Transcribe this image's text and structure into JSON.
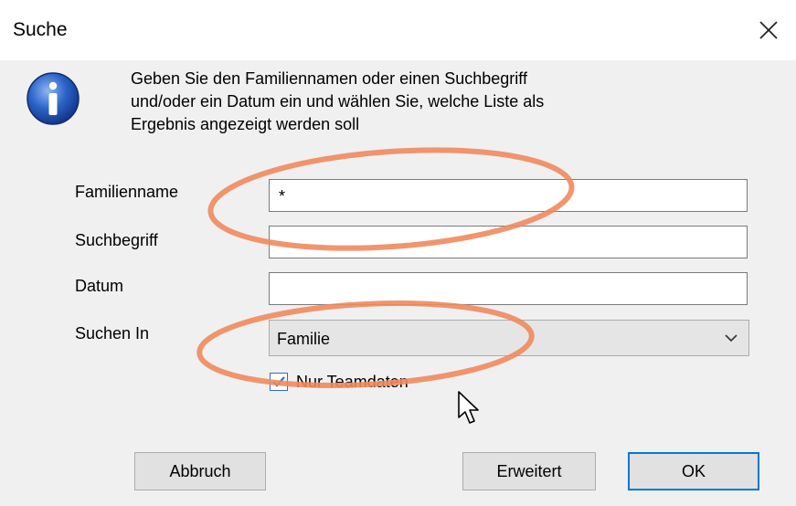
{
  "window": {
    "title": "Suche"
  },
  "message": {
    "lines": [
      "Geben Sie den Familiennamen oder einen Suchbegriff",
      "und/oder ein Datum ein und wählen Sie, welche Liste als",
      "Ergebnis angezeigt werden soll"
    ]
  },
  "form": {
    "familienname": {
      "label": "Familienname",
      "value": "*"
    },
    "suchbegriff": {
      "label": "Suchbegriff",
      "value": ""
    },
    "datum": {
      "label": "Datum",
      "value": ""
    },
    "suchen_in": {
      "label": "Suchen In",
      "value": "Familie"
    },
    "nur_teamdaten": {
      "label": "Nur Teamdaten",
      "checked": true
    }
  },
  "buttons": {
    "abbruch": "Abbruch",
    "erweitert": "Erweitert",
    "ok": "OK"
  },
  "icons": {
    "info": "info-icon",
    "close": "close-icon",
    "dropdown": "chevron-down-icon",
    "cursor": "mouse-cursor-icon"
  },
  "colors": {
    "highlight_ellipse": "#f08a5d",
    "checkbox_accent": "#2f6fbf",
    "default_button_border": "#0078d7"
  }
}
